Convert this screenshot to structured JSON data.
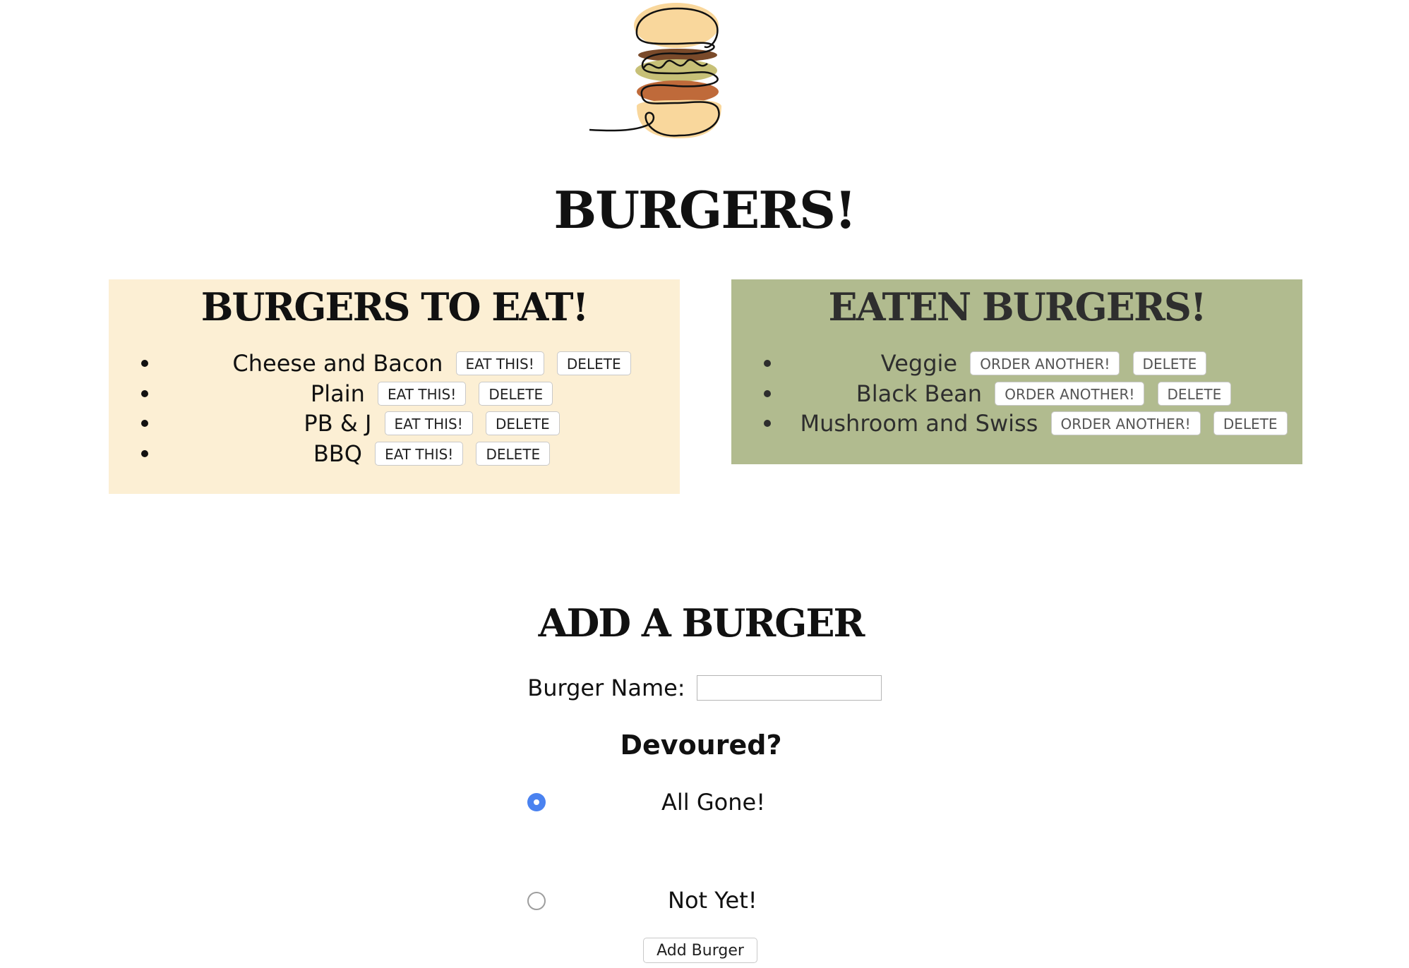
{
  "logo": {
    "icon": "burger-line-art-icon",
    "colors": {
      "bun": "#f9d79c",
      "patty_dark": "#7a4a2a",
      "cheese": "#c7c077",
      "patty": "#bf6a3a"
    }
  },
  "page_title": "BURGERS!",
  "to_eat": {
    "heading": "BURGERS TO EAT!",
    "background": "#fcefd4",
    "items": [
      {
        "name": "Cheese and Bacon",
        "action": "EAT THIS!",
        "delete": "DELETE"
      },
      {
        "name": "Plain",
        "action": "EAT THIS!",
        "delete": "DELETE"
      },
      {
        "name": "PB & J",
        "action": "EAT THIS!",
        "delete": "DELETE"
      },
      {
        "name": "BBQ",
        "action": "EAT THIS!",
        "delete": "DELETE"
      }
    ]
  },
  "eaten": {
    "heading": "EATEN BURGERS!",
    "background": "#b1bb8f",
    "items": [
      {
        "name": "Veggie",
        "action": "ORDER ANOTHER!",
        "delete": "DELETE"
      },
      {
        "name": "Black Bean",
        "action": "ORDER ANOTHER!",
        "delete": "DELETE"
      },
      {
        "name": "Mushroom and Swiss",
        "action": "ORDER ANOTHER!",
        "delete": "DELETE"
      }
    ]
  },
  "form": {
    "heading": "ADD A BURGER",
    "name_label": "Burger Name:",
    "name_value": "",
    "devoured_label": "Devoured?",
    "options": [
      {
        "label": "All Gone!",
        "checked": true
      },
      {
        "label": "Not Yet!",
        "checked": false
      }
    ],
    "submit_label": "Add Burger",
    "radio_accent": "#4a82f0"
  }
}
